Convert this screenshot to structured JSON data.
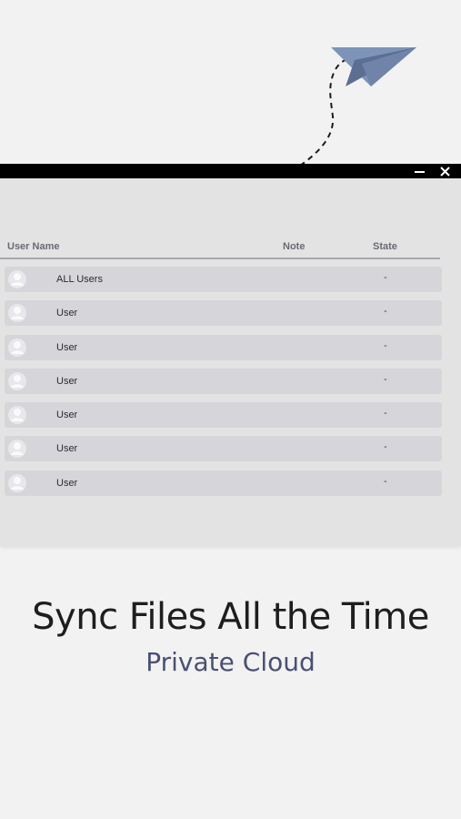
{
  "window": {
    "minimize_icon": "minimize-icon",
    "close_icon": "close-icon",
    "close_glyph": "✕"
  },
  "table": {
    "headers": {
      "name": "User Name",
      "note": "Note",
      "state": "State"
    },
    "rows": [
      {
        "name": "ALL Users",
        "note": "",
        "state": "-"
      },
      {
        "name": "User",
        "note": "",
        "state": "-"
      },
      {
        "name": "User",
        "note": "",
        "state": "-"
      },
      {
        "name": "User",
        "note": "",
        "state": "-"
      },
      {
        "name": "User",
        "note": "",
        "state": "-"
      },
      {
        "name": "User",
        "note": "",
        "state": "-"
      },
      {
        "name": "User",
        "note": "",
        "state": "-"
      }
    ]
  },
  "promo": {
    "title": "Sync Files All the Time",
    "subtitle": "Private Cloud"
  },
  "colors": {
    "background": "#f2f2f2",
    "window_bg": "#e3e3e3",
    "row_bg": "#d6d6da",
    "plane": "#6f84a8",
    "subtitle": "#4a5073"
  }
}
